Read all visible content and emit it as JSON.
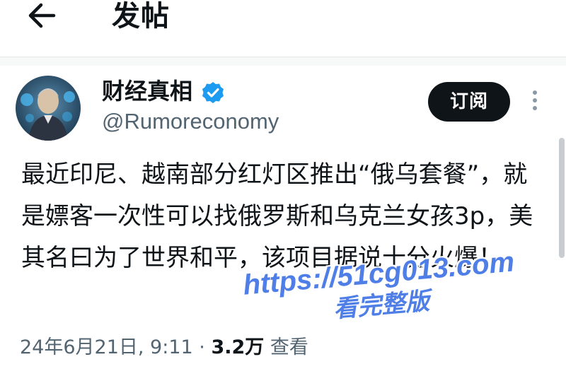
{
  "header": {
    "back_icon": "arrow-left-icon",
    "title": "发帖"
  },
  "post": {
    "author": {
      "display_name": "财经真相",
      "verified_icon": "verified-badge-icon",
      "verified_color": "#1d9bf0",
      "handle": "@Rumoreconomy",
      "avatar": "avatar-image"
    },
    "subscribe_label": "订阅",
    "more_icon": "more-vertical-icon",
    "text": "最近印尼、越南部分红灯区推出“俄乌套餐”，就是嫖客一次性可以找俄罗斯和乌克兰女孩3p，美其名曰为了世界和平，该项目据说十分火爆！",
    "meta": {
      "date_time": "24年6月21日, 9:11 · ",
      "views": "3.2万",
      "views_label": " 查看"
    }
  },
  "watermark": {
    "url": "https://51cg013.com",
    "cta": "看完整版",
    "color": "#4f7fe6"
  }
}
